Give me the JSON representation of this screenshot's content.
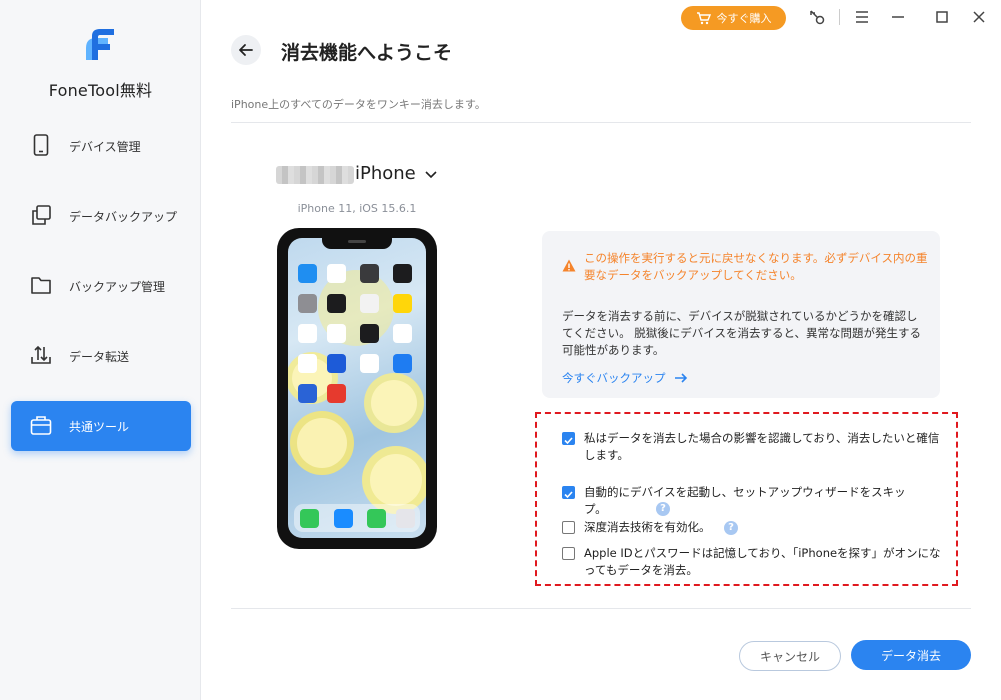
{
  "app": {
    "name": "FoneTool無料"
  },
  "titlebar": {
    "buy_label": "今すぐ購入"
  },
  "sidebar": {
    "items": [
      {
        "label": "デバイス管理",
        "icon": "phone-icon",
        "active": false
      },
      {
        "label": "データバックアップ",
        "icon": "copy-icon",
        "active": false
      },
      {
        "label": "バックアップ管理",
        "icon": "folder-icon",
        "active": false
      },
      {
        "label": "データ転送",
        "icon": "transfer-icon",
        "active": false
      },
      {
        "label": "共通ツール",
        "icon": "toolbox-icon",
        "active": true
      }
    ]
  },
  "header": {
    "title": "消去機能へようこそ",
    "subtitle": "iPhone上のすべてのデータをワンキー消去します。"
  },
  "device": {
    "name": "iPhone",
    "model": "iPhone 11, iOS 15.6.1"
  },
  "warning": {
    "text": "この操作を実行すると元に戻せなくなります。必ずデバイス内の重要なデータをバックアップしてください。",
    "info": "データを消去する前に、デバイスが脱獄されているかどうかを確認してください。 脱獄後にデバイスを消去すると、異常な問題が発生する可能性があります。",
    "link_label": "今すぐバックアップ"
  },
  "options": [
    {
      "label": "私はデータを消去した場合の影響を認識しており、消去したいと確信します。",
      "checked": true
    },
    {
      "label": "自動的にデバイスを起動し、セットアップウィザードをスキップ。",
      "checked": true
    },
    {
      "label": "深度消去技術を有効化。",
      "checked": false
    },
    {
      "label": "Apple IDとパスワードは記憶しており、「iPhoneを探す」がオンになってもデータを消去。",
      "checked": false
    }
  ],
  "buttons": {
    "cancel": "キャンセル",
    "erase": "データ消去"
  },
  "colors": {
    "accent": "#2b84f0",
    "warning": "#f5842c",
    "buy": "#f59a23",
    "frame": "#e0191f"
  }
}
